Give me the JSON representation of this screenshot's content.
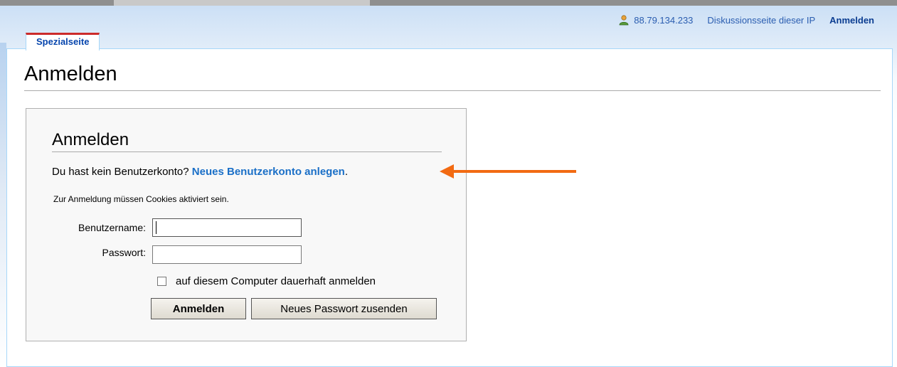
{
  "header": {
    "ip": "88.79.134.233",
    "talk_link": "Diskussionsseite dieser IP",
    "login_link": "Anmelden",
    "tab_label": "Spezialseite"
  },
  "page": {
    "title": "Anmelden"
  },
  "login_box": {
    "heading": "Anmelden",
    "no_account_text": "Du hast kein Benutzerkonto? ",
    "create_account_link": "Neues Benutzerkonto anlegen",
    "create_account_suffix": ".",
    "cookie_note": "Zur Anmeldung müssen Cookies aktiviert sein.",
    "username_label": "Benutzername:",
    "username_value": "",
    "password_label": "Passwort:",
    "password_value": "",
    "remember_label": "auf diesem Computer dauerhaft anmelden",
    "remember_checked": false,
    "login_button": "Anmelden",
    "new_password_button": "Neues Passwort zusenden"
  },
  "colors": {
    "arrow": "#f26a12",
    "link": "#1a6fc7",
    "tab_accent": "#cc2b2b"
  },
  "icons": {
    "user": "user-icon"
  }
}
